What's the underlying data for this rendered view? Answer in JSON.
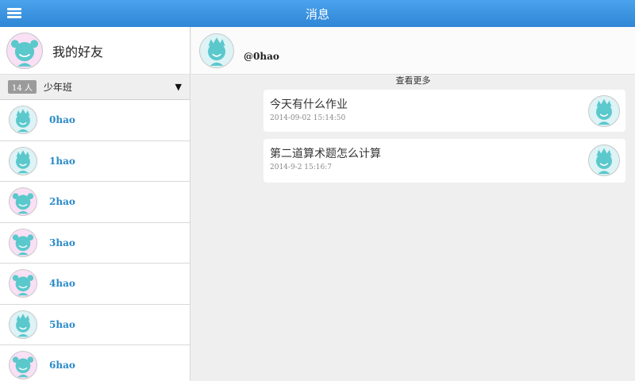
{
  "header": {
    "title": "消息",
    "menu_icon": "hamburger-menu-icon"
  },
  "me": {
    "title": "我的好友",
    "avatar": "girl-avatar-icon"
  },
  "group": {
    "count": "14 人",
    "name": "少年班",
    "expand_icon": "chevron-down-icon"
  },
  "friends": [
    {
      "name": "0hao",
      "avatar": "boy"
    },
    {
      "name": "1hao",
      "avatar": "boy"
    },
    {
      "name": "2hao",
      "avatar": "girl"
    },
    {
      "name": "3hao",
      "avatar": "girl"
    },
    {
      "name": "4hao",
      "avatar": "girl"
    },
    {
      "name": "5hao",
      "avatar": "boy"
    },
    {
      "name": "6hao",
      "avatar": "girl"
    }
  ],
  "chat": {
    "peer": "@0hao",
    "load_more": "查看更多",
    "messages": [
      {
        "text": "今天有什么作业",
        "time": "2014-09-02 15:14:50"
      },
      {
        "text": "第二道算术题怎么计算",
        "time": "2014-9-2 15:16:7"
      }
    ]
  },
  "colors": {
    "header": "#3a94e0",
    "friend_name": "#2a8ac9",
    "boy_avatar": "#5bc8cc",
    "girl_avatar": "#f9e0f4"
  }
}
